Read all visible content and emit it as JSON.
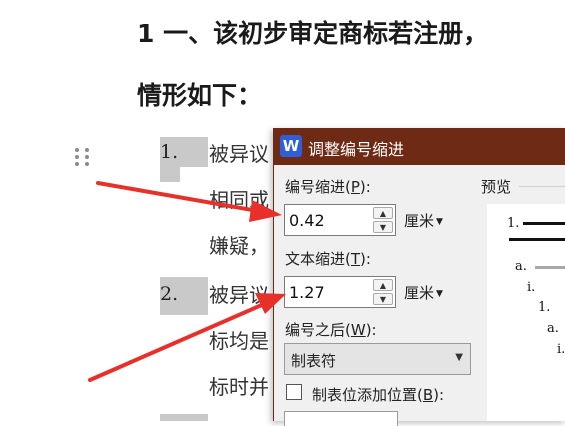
{
  "document": {
    "heading_line1": "1 一、该初步审定商标若注册，",
    "heading_line2": "情形如下：",
    "items": [
      {
        "number": "1.",
        "line1": "被异议",
        "line2": "相同或",
        "line3": "嫌疑，"
      },
      {
        "number": "2.",
        "line1": "被异议",
        "line2": "标均是",
        "line3": "标时并"
      }
    ]
  },
  "dialog": {
    "title": "调整编号缩进",
    "app_icon_letter": "W",
    "number_indent": {
      "label": "编号缩进(",
      "key": "P",
      "label_tail": "):",
      "value": "0.42",
      "unit": "厘米"
    },
    "text_indent": {
      "label": "文本缩进(",
      "key": "T",
      "label_tail": "):",
      "value": "1.27",
      "unit": "厘米"
    },
    "after_number": {
      "label": "编号之后(",
      "key": "W",
      "label_tail": "):",
      "value": "制表符"
    },
    "tab_stop": {
      "label": "制表位添加位置(",
      "key": "B",
      "label_tail": "):",
      "checked": false
    },
    "preview": {
      "label": "预览",
      "levels": [
        "1.",
        "a.",
        "i.",
        "1.",
        "a.",
        "i."
      ]
    }
  },
  "colors": {
    "titlebar": "#6e2a14",
    "arrow": "#e8302a",
    "number_highlight": "#c9c9c9",
    "app_icon": "#2f5ed8"
  }
}
